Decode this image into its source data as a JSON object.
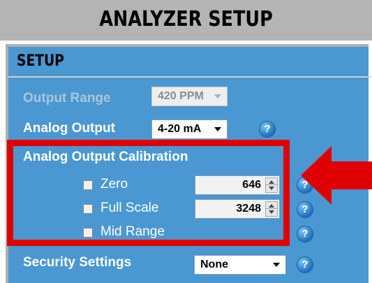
{
  "header": {
    "title": "ANALYZER SETUP"
  },
  "setup": {
    "section_title": "SETUP",
    "output_range": {
      "label": "Output Range",
      "value": "420 PPM"
    },
    "analog_output": {
      "label": "Analog Output",
      "value": "4-20 mA"
    },
    "calibration": {
      "title": "Analog Output Calibration",
      "zero": {
        "label": "Zero",
        "value": "646"
      },
      "full_scale": {
        "label": "Full Scale",
        "value": "3248"
      },
      "mid_range": {
        "label": "Mid Range"
      }
    },
    "security": {
      "label": "Security Settings",
      "value": "None"
    },
    "help_glyph": "?"
  },
  "colors": {
    "panel": "#4a97d2",
    "header": "#b4b4b4",
    "highlight": "#e00000"
  },
  "icons": {
    "help": "question-circle-icon",
    "pointer": "red-arrow-left-icon",
    "dropdown": "chevron-down-icon"
  }
}
